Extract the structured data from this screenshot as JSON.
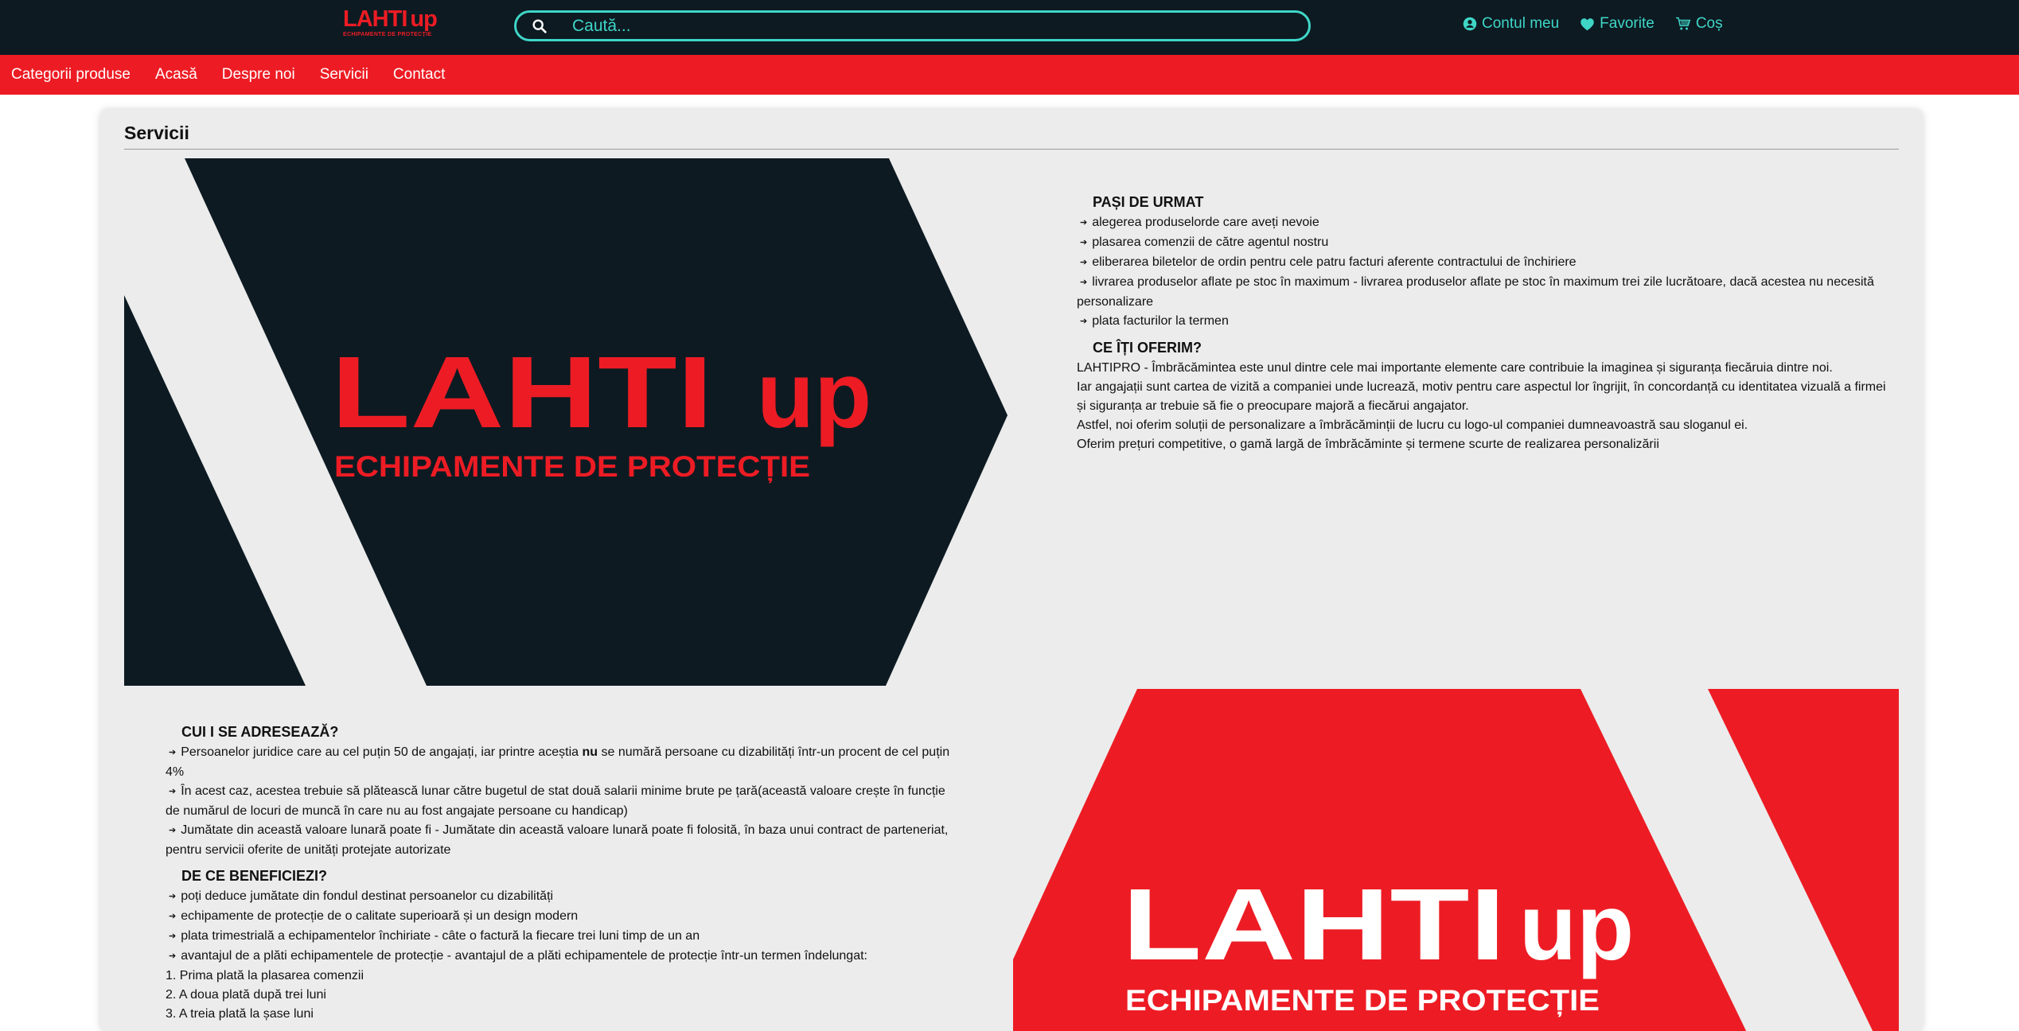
{
  "header": {
    "logo_text": "LAHTI",
    "logo_up": "up",
    "logo_tagline": "ECHIPAMENTE DE PROTECȚIE",
    "search_placeholder": "Caută...",
    "account_label": "Contul meu",
    "favorites_label": "Favorite",
    "cart_label": "Coș"
  },
  "nav": {
    "items": [
      "Categorii produse",
      "Acasă",
      "Despre noi",
      "Servicii",
      "Contact"
    ]
  },
  "page": {
    "title": "Servicii",
    "banner1": {
      "brand": "LAHTI",
      "brand_up": "up",
      "tagline": "ECHIPAMENTE DE PROTECȚIE"
    },
    "banner2": {
      "brand": "LAHTI",
      "brand_up": "up",
      "tagline": "ECHIPAMENTE DE PROTECȚIE"
    },
    "steps": {
      "heading": "PAȘI DE URMAT",
      "items": [
        "alegerea produselorde care aveți nevoie",
        "plasarea comenzii de către agentul nostru",
        "eliberarea biletelor de ordin pentru cele patru facturi aferente contractului de închiriere",
        "livrarea produselor aflate pe stoc în maximum - livrarea produselor aflate pe stoc în maximum trei zile lucrătoare, dacă acestea nu necesită personalizare",
        "plata facturilor la termen"
      ]
    },
    "offer": {
      "heading": "CE ÎȚI OFERIM?",
      "paragraphs": [
        "LAHTIPRO - Îmbrăcămintea este unul dintre cele mai importante elemente care contribuie la imaginea și siguranța fiecăruia dintre noi.",
        "Iar angajații sunt cartea de vizită a companiei unde lucrează, motiv pentru care aspectul lor îngrijit, în concordanță cu identitatea vizuală a firmei și siguranța ar trebuie să fie o preocupare majoră a fiecărui angajator.",
        "Astfel, noi oferim soluții de personalizare a îmbrăcăminții de lucru cu logo-ul companiei dumneavoastră sau sloganul ei.",
        "Oferim prețuri competitive, o gamă largă de îmbrăcăminte și termene scurte de realizarea personalizării"
      ]
    },
    "audience": {
      "heading": "CUI I SE ADRESEAZĂ?",
      "item1_before": "Persoanelor juridice care au cel puțin 50 de angajați, iar printre aceștia ",
      "item1_bold": "nu",
      "item1_after": " se numără persoane cu dizabilități într-un procent de cel puțin 4%",
      "item2": "În acest caz, acestea trebuie să plătească lunar către bugetul de stat două salarii minime brute pe țară(această valoare crește în funcție de numărul de locuri de muncă în care nu au fost angajate persoane cu handicap)",
      "item3": "Jumătate din această valoare lunară poate fi - Jumătate din această valoare lunară poate fi folosită, în baza unui contract de parteneriat, pentru servicii oferite de unități protejate autorizate"
    },
    "benefits": {
      "heading": "DE CE BENEFICIEZI?",
      "items": [
        "poți deduce jumătate din fondul destinat persoanelor cu dizabilități",
        "echipamente de protecție de o calitate superioară și un design modern",
        "plata trimestrială a echipamentelor închiriate - câte o factură la fiecare trei luni timp de un an",
        "avantajul de a plăti echipamentele de protecție - avantajul de a plăti echipamentele de protecție într-un termen îndelungat:"
      ],
      "numbered": [
        "1. Prima plată la plasarea comenzii",
        "2. A doua plată după trei luni",
        "3. A treia plată la șase luni"
      ]
    }
  },
  "colors": {
    "header_bg": "#0d1a22",
    "accent_teal": "#3fd6c7",
    "brand_red": "#ed1c24",
    "card_bg": "#ececec"
  }
}
